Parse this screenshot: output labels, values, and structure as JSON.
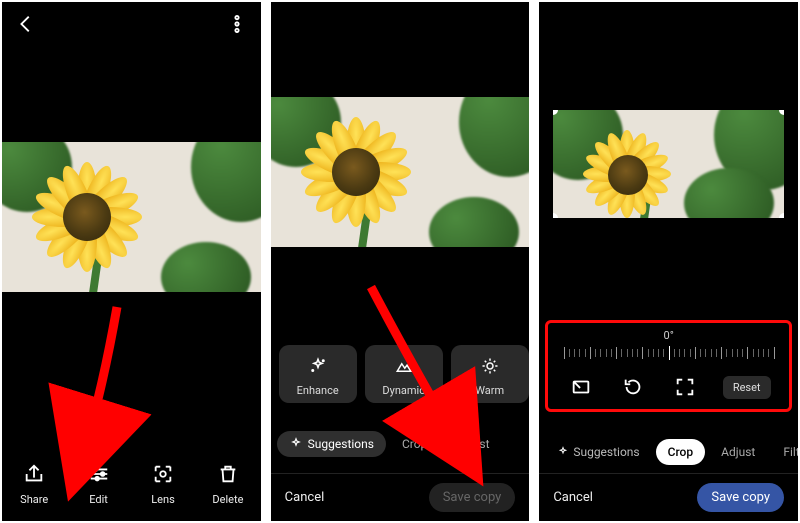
{
  "panel1": {
    "actions": {
      "share": "Share",
      "edit": "Edit",
      "lens": "Lens",
      "delete": "Delete"
    }
  },
  "panel2": {
    "suggestions": {
      "enhance": "Enhance",
      "dynamic": "Dynamic",
      "warm": "Warm"
    },
    "tabs": {
      "suggestions": "Suggestions",
      "crop": "Crop",
      "adjust": "Adjust"
    },
    "cancel": "Cancel",
    "save": "Save copy"
  },
  "panel3": {
    "degree_label": "0°",
    "reset": "Reset",
    "tabs": {
      "suggestions": "Suggestions",
      "crop": "Crop",
      "adjust": "Adjust",
      "filters": "Filters"
    },
    "cancel": "Cancel",
    "save": "Save copy"
  }
}
